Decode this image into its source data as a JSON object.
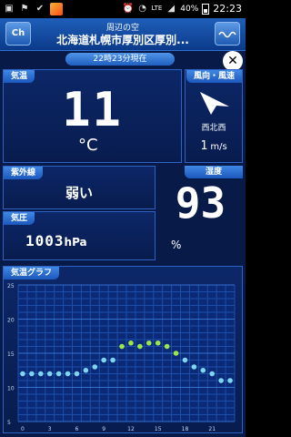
{
  "status_bar": {
    "battery_percent": "40%",
    "network": "LTE",
    "time": "22:23"
  },
  "header": {
    "left_button_label": "Ch",
    "subtitle": "周辺の空",
    "title": "北海道札幌市厚別区厚別..."
  },
  "time_banner": "22時23分現在",
  "temperature": {
    "label": "気温",
    "value": "11",
    "unit": "°C"
  },
  "wind": {
    "label": "風向・風速",
    "direction": "西北西",
    "speed_value": "1",
    "speed_unit": "m/s"
  },
  "uv": {
    "label": "紫外線",
    "value": "弱い"
  },
  "humidity": {
    "label": "湿度",
    "value": "93",
    "unit": "%"
  },
  "pressure": {
    "label": "気圧",
    "value": "1003",
    "unit": "hPa"
  },
  "graph": {
    "label": "気温グラフ"
  },
  "chart_data": {
    "type": "scatter",
    "title": "気温グラフ",
    "x_ticks": [
      0,
      3,
      6,
      9,
      12,
      15,
      18,
      21
    ],
    "y_ticks": [
      5,
      10,
      15,
      20,
      25
    ],
    "ylim": [
      5,
      25
    ],
    "xlim": [
      -0.5,
      23.5
    ],
    "grid": true,
    "series": [
      {
        "color": "#7fd4f0",
        "x": [
          0,
          1,
          2,
          3,
          4,
          5,
          6,
          7,
          8,
          9,
          10,
          18,
          19,
          20,
          21,
          22,
          23
        ],
        "y": [
          12,
          12,
          12,
          12,
          12,
          12,
          12,
          12.5,
          13,
          14,
          14,
          14,
          13,
          12.5,
          12,
          11,
          11
        ]
      },
      {
        "color": "#9be74a",
        "x": [
          11,
          12,
          13,
          14,
          15,
          16,
          17
        ],
        "y": [
          16,
          16.5,
          16,
          16.5,
          16.5,
          16,
          15
        ]
      }
    ]
  }
}
